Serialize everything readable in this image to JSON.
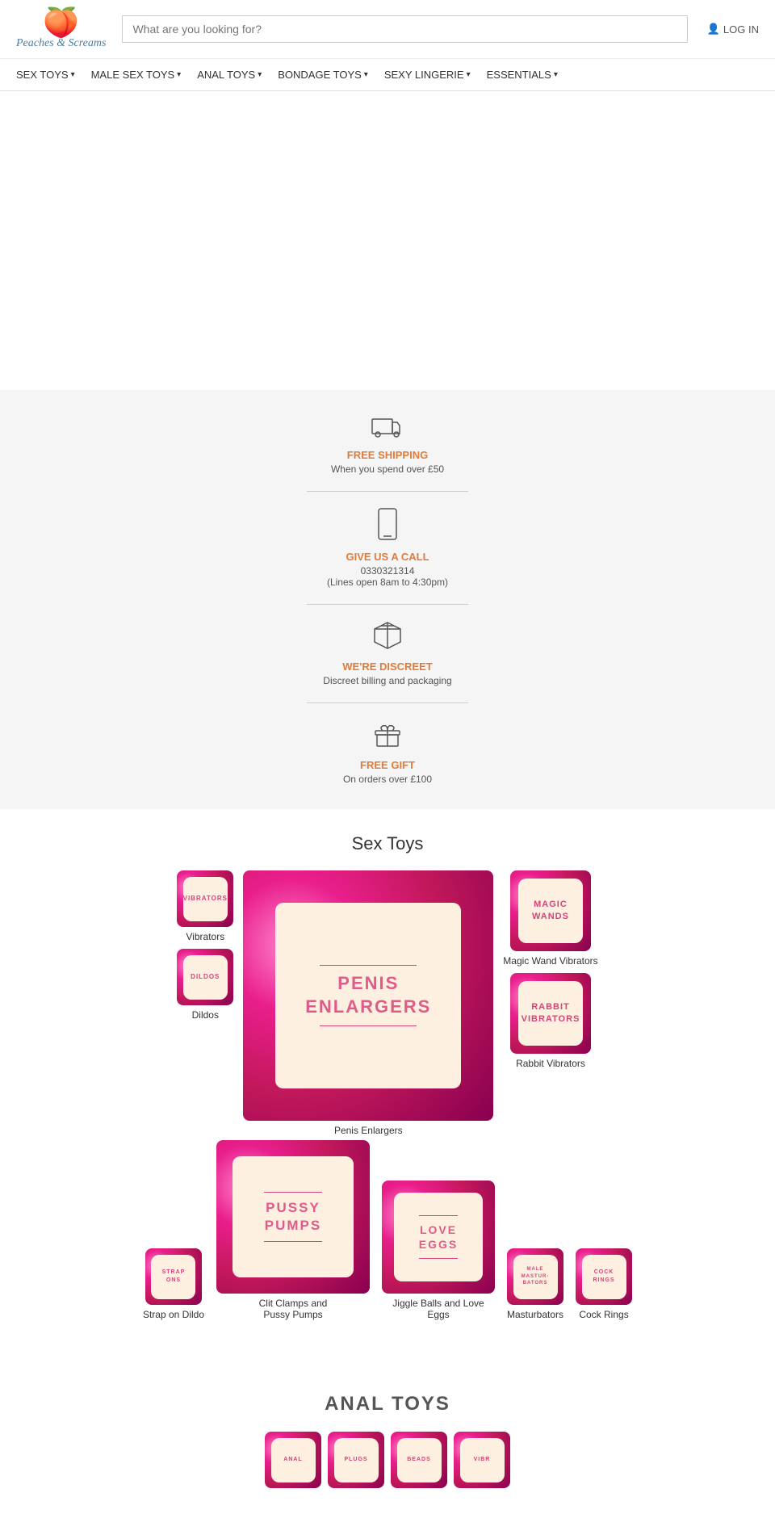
{
  "header": {
    "logo_emoji": "🍑",
    "logo_name": "Peaches & Screams",
    "search_placeholder": "What are you looking for?",
    "login_label": "LOG IN"
  },
  "nav": {
    "items": [
      {
        "label": "SEX TOYS",
        "has_dropdown": true
      },
      {
        "label": "MALE SEX TOYS",
        "has_dropdown": true
      },
      {
        "label": "ANAL TOYS",
        "has_dropdown": true
      },
      {
        "label": "BONDAGE TOYS",
        "has_dropdown": true
      },
      {
        "label": "SEXY LINGERIE",
        "has_dropdown": true
      },
      {
        "label": "ESSENTIALS",
        "has_dropdown": true
      }
    ]
  },
  "info": {
    "items": [
      {
        "icon": "🚚",
        "title": "FREE SHIPPING",
        "desc": "When you spend over £50"
      },
      {
        "icon": "📱",
        "title": "GIVE US A CALL",
        "phone": "0330321314",
        "desc": "(Lines open 8am to 4:30pm)"
      },
      {
        "icon": "📦",
        "title": "WE'RE DISCREET",
        "desc": "Discreet billing and packaging"
      },
      {
        "icon": "🎁",
        "title": "FREE GIFT",
        "desc": "On orders over £100"
      }
    ]
  },
  "sex_toys_section": {
    "title": "Sex Toys",
    "products": [
      {
        "name": "Vibrators",
        "size": "small"
      },
      {
        "name": "Dildos",
        "size": "small"
      },
      {
        "name": "Penis Enlargers",
        "size": "large",
        "card_text": "PENIS\nENLARGERS"
      },
      {
        "name": "Magic Wand Vibrators",
        "card_text": "MAGIC\nWANDS",
        "size": "medium"
      },
      {
        "name": "Rabbit Vibrators",
        "card_text": "RABBIT\nVIBRATORS",
        "size": "medium"
      },
      {
        "name": "Strap on Dildo",
        "card_text": "STRAP\nONS",
        "size": "small"
      },
      {
        "name": "Clit Clamps and Pussy Pumps",
        "card_text": "PUSSY PUMPS",
        "size": "large_medium"
      },
      {
        "name": "Jiggle Balls and Love Eggs",
        "card_text": "LOVE EGGS",
        "size": "medium"
      },
      {
        "name": "Masturbators",
        "card_text": "MALE\nMASTURBATORS",
        "size": "small"
      },
      {
        "name": "Cock Rings",
        "card_text": "COCK\nRINGS",
        "size": "small"
      }
    ]
  },
  "anal_toys_section": {
    "title": "ANAL TOYS"
  }
}
